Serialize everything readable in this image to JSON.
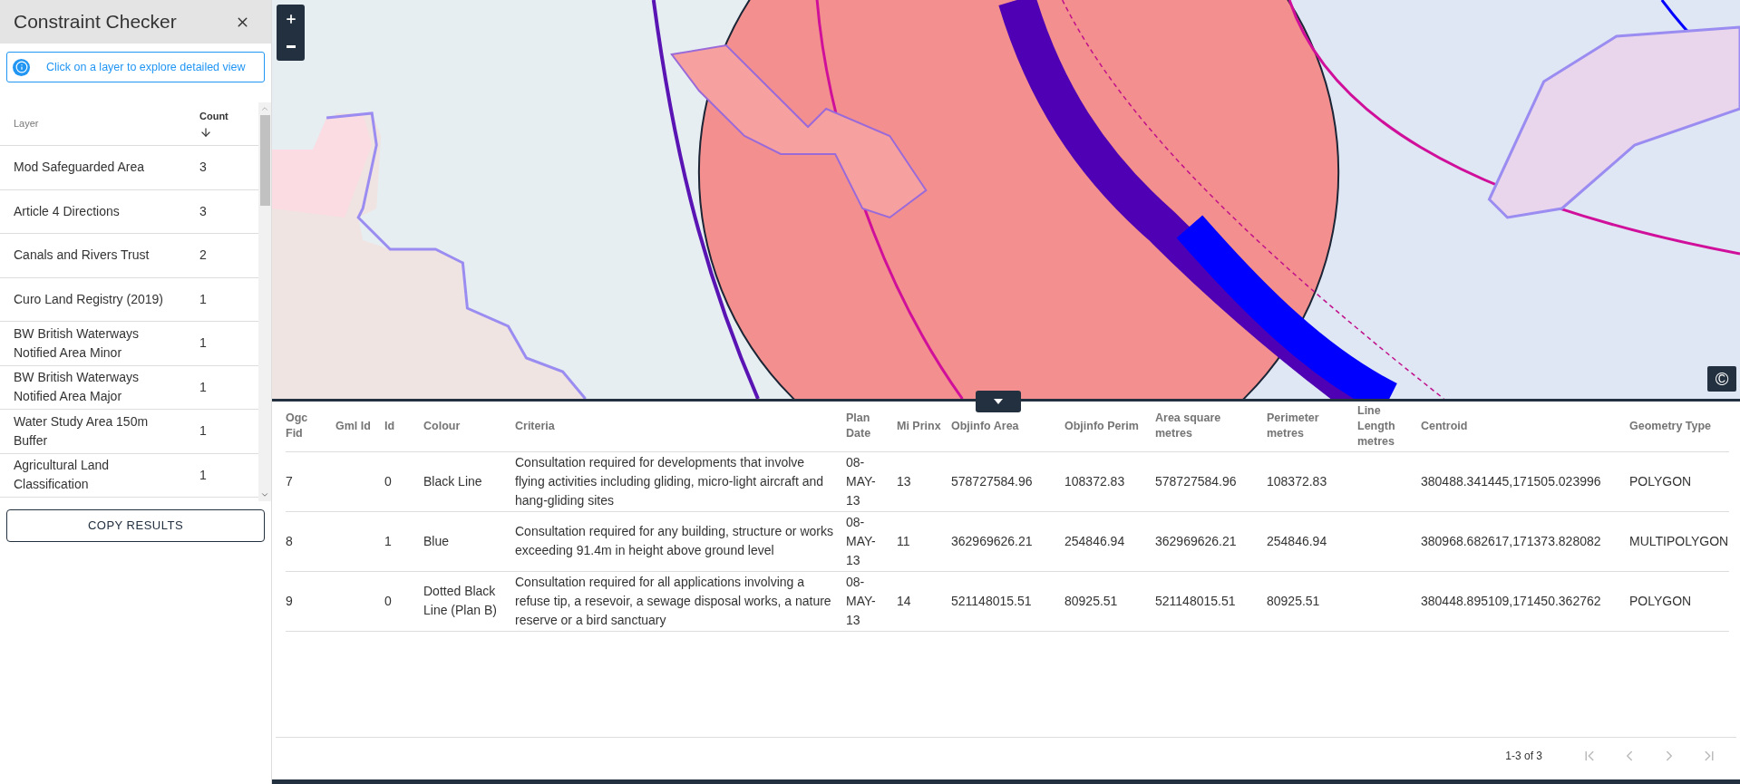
{
  "panel": {
    "title": "Constraint Checker",
    "info": "Click on a layer to explore detailed view",
    "columns": [
      {
        "label": "Layer",
        "sorted": false
      },
      {
        "label": "Count",
        "sorted": true
      }
    ],
    "layers": [
      {
        "name": "Mod Safeguarded Area",
        "count": "3"
      },
      {
        "name": "Article 4 Directions",
        "count": "3"
      },
      {
        "name": "Canals and Rivers Trust",
        "count": "2"
      },
      {
        "name": "Curo Land Registry (2019)",
        "count": "1"
      },
      {
        "name": "BW British Waterways Notified Area Minor",
        "count": "1"
      },
      {
        "name": "BW British Waterways Notified Area Major",
        "count": "1"
      },
      {
        "name": "Water Study Area 150m Buffer",
        "count": "1"
      },
      {
        "name": "Agricultural Land Classification",
        "count": "1"
      }
    ],
    "copy_button": "COPY RESULTS"
  },
  "map": {
    "attribution": "©"
  },
  "results": {
    "columns": [
      "Ogc Fid",
      "Gml Id",
      "Id",
      "Colour",
      "Criteria",
      "Plan Date",
      "Mi Prinx",
      "Objinfo Area",
      "Objinfo Perim",
      "Area square metres",
      "Perimeter metres",
      "Line Length metres",
      "Centroid",
      "Geometry Type"
    ],
    "rows": [
      [
        "7",
        "",
        "0",
        "Black Line",
        "Consultation required for developments that involve flying activities including gliding, micro-light aircraft and hang-gliding sites",
        "08-MAY-13",
        "13",
        "578727584.96",
        "108372.83",
        "578727584.96",
        "108372.83",
        "",
        "380488.341445,171505.023996",
        "POLYGON"
      ],
      [
        "8",
        "",
        "1",
        "Blue",
        "Consultation required for any building, structure or works exceeding 91.4m in height above ground level",
        "08-MAY-13",
        "11",
        "362969626.21",
        "254846.94",
        "362969626.21",
        "254846.94",
        "",
        "380968.682617,171373.828082",
        "MULTIPOLYGON"
      ],
      [
        "9",
        "",
        "0",
        "Dotted Black Line (Plan B)",
        "Consultation required for all applications involving a refuse tip, a resevoir, a sewage disposal works, a nature reserve or a bird sanctuary",
        "08-MAY-13",
        "14",
        "521148015.51",
        "80925.51",
        "521148015.51",
        "80925.51",
        "",
        "380448.895109,171450.362762",
        "POLYGON"
      ]
    ],
    "pagination": "1-3 of 3",
    "page_buttons": [
      {
        "kind": "first",
        "disabled": true
      },
      {
        "kind": "prev",
        "disabled": true
      },
      {
        "kind": "next",
        "disabled": true
      },
      {
        "kind": "last",
        "disabled": true
      }
    ]
  }
}
